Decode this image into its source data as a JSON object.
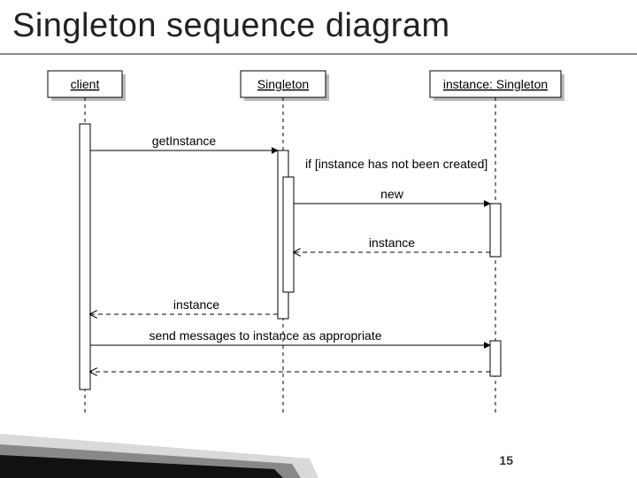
{
  "title": "Singleton sequence diagram",
  "page_number": "15",
  "participants": {
    "client": "client",
    "singleton": "Singleton",
    "instance": "instance: Singleton"
  },
  "messages": {
    "getInstance": "getInstance",
    "guard": "if [instance has not been created]",
    "new": "new",
    "instance_return1": "instance",
    "instance_return2": "instance",
    "send": "send messages to instance as appropriate"
  }
}
